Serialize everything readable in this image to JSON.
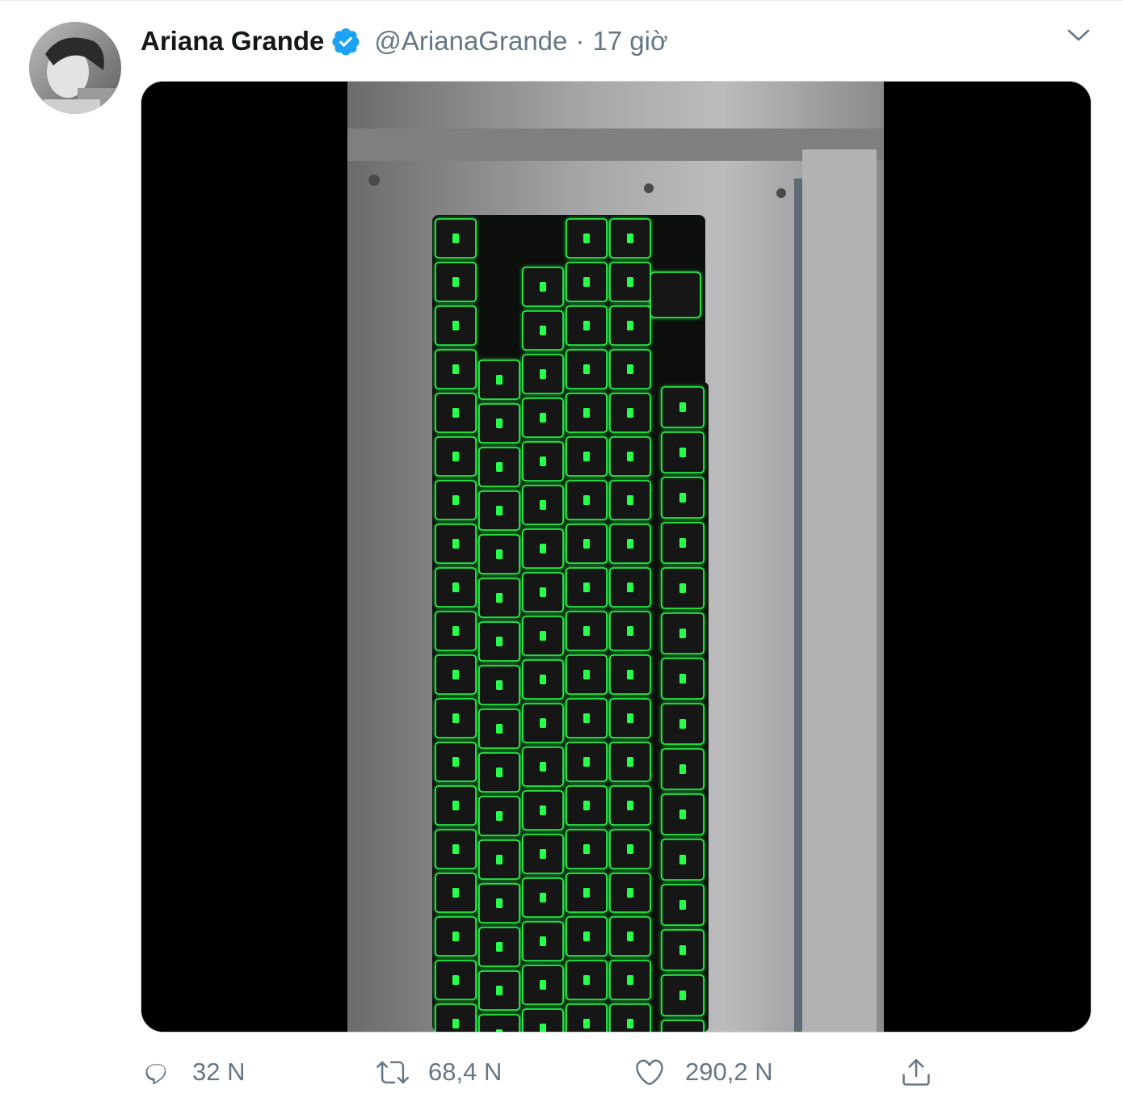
{
  "tweet": {
    "author_name": "Ariana Grande",
    "handle": "@ArianaGrande",
    "separator": "·",
    "timestamp": "17 giờ",
    "verified": true,
    "media_type": "video-keyboard-green-backlit"
  },
  "actions": {
    "reply_count": "32 N",
    "retweet_count": "68,4 N",
    "like_count": "290,2 N"
  },
  "icons": {
    "verified": "verified-badge-icon",
    "caret": "chevron-down-icon",
    "reply": "reply-icon",
    "retweet": "retweet-icon",
    "like": "heart-icon",
    "share": "share-icon"
  },
  "colors": {
    "verified_blue": "#1da1f2",
    "secondary_text": "#657786",
    "key_glow": "#27ff4a"
  }
}
